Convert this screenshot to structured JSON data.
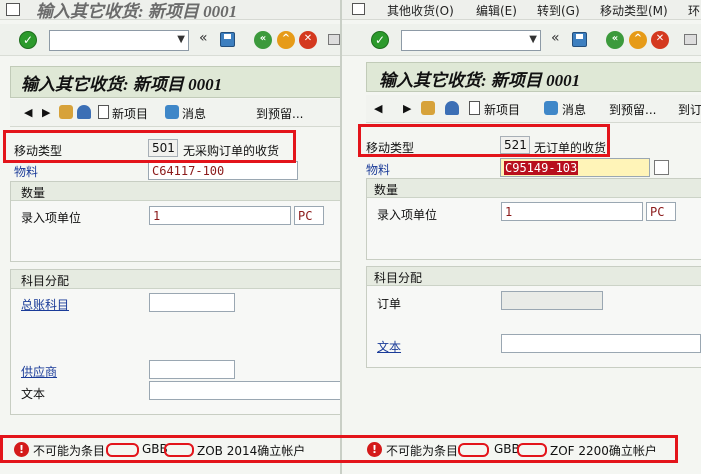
{
  "left": {
    "title": "输入其它收货: 新项目 0001",
    "panel_title": "输入其它收货: 新项目 0001",
    "toolbar": {
      "new_item": "新项目",
      "message": "消息",
      "to_reserve": "到预留..."
    },
    "movement_type": {
      "label": "移动类型",
      "code": "501",
      "text": "无采购订单的收货"
    },
    "material": {
      "label": "物料",
      "value": "C64117-100"
    },
    "quantity_group": {
      "title": "数量",
      "entry_unit_label": "录入项单位",
      "qty": "1",
      "unit": "PC"
    },
    "account_group": {
      "title": "科目分配",
      "gl_account_label": "总账科目",
      "vendor_label": "供应商",
      "text_label": "文本"
    },
    "status": {
      "prefix": "不可能为条目",
      "mid": "GBB",
      "suffix": "ZOB 2014确立帐户"
    }
  },
  "right": {
    "menu": [
      "其他收货(O)",
      "编辑(E)",
      "转到(G)",
      "移动类型(M)",
      "环"
    ],
    "panel_title": "输入其它收货: 新项目 0001",
    "toolbar": {
      "new_item": "新项目",
      "message": "消息",
      "to_reserve": "到预留...",
      "to_order": "到订"
    },
    "movement_type": {
      "label": "移动类型",
      "code": "521",
      "text": "无订单的收货"
    },
    "material": {
      "label": "物料",
      "value": "C95149-103"
    },
    "quantity_group": {
      "title": "数量",
      "entry_unit_label": "录入项单位",
      "qty": "1",
      "unit": "PC"
    },
    "account_group": {
      "title": "科目分配",
      "order_label": "订单",
      "text_label": "文本"
    },
    "status": {
      "prefix": "不可能为条目",
      "mid": "GBB",
      "suffix": "ZOF 2200确立帐户"
    }
  },
  "colors": {
    "highlight": "#e3141b",
    "link": "#1b3c99",
    "value": "#8b1a1a",
    "panel": "#dfe8d6"
  }
}
